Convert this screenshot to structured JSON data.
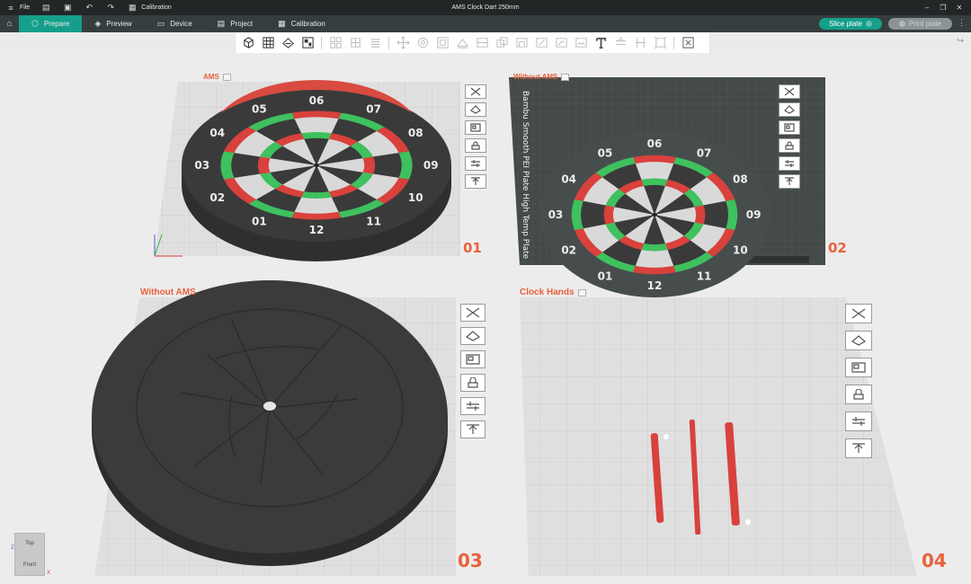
{
  "titlebar": {
    "file_label": "File",
    "calibration_label": "Calibration",
    "title": "AMS Clock Dart 250mm"
  },
  "nav": {
    "tabs": [
      {
        "label": "Prepare",
        "icon": "cube-icon",
        "active": true
      },
      {
        "label": "Preview",
        "icon": "layers-icon",
        "active": false
      },
      {
        "label": "Device",
        "icon": "device-icon",
        "active": false
      },
      {
        "label": "Project",
        "icon": "project-icon",
        "active": false
      },
      {
        "label": "Calibration",
        "icon": "calibration-icon",
        "active": false
      }
    ],
    "slice_label": "Slice plate",
    "print_label": "Print plate"
  },
  "plates": [
    {
      "name": "AMS",
      "number": "01"
    },
    {
      "name": "Without AMS",
      "number": "02"
    },
    {
      "name": "Without AMS",
      "number": "03"
    },
    {
      "name": "Clock Hands",
      "number": "04"
    }
  ],
  "dartboard_numbers": [
    "06",
    "07",
    "08",
    "09",
    "10",
    "11",
    "12",
    "01",
    "02",
    "03",
    "04",
    "05"
  ],
  "build_plate_text": "Bambu Smooth PEI Plate High Temp Plate",
  "viewcube": {
    "top": "Top",
    "front": "Front",
    "z": "Z",
    "x": "X"
  },
  "colors": {
    "accent": "#159f8a",
    "plate_label": "#e8623b",
    "red": "#d9413c",
    "green": "#3ec15e",
    "dark": "#3a3a3a",
    "light": "#d9d9d9"
  }
}
